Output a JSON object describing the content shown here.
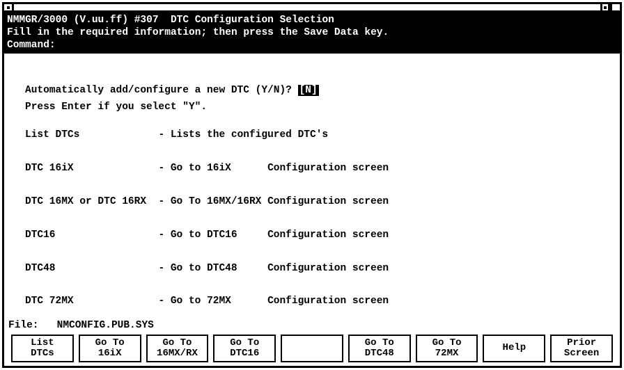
{
  "header": {
    "line1": "NMMGR/3000 (V.uu.ff) #307  DTC Configuration Selection",
    "line2": "Fill in the required information; then press the Save Data key.",
    "command_label": "Command:"
  },
  "prompt": {
    "question": "Automatically add/configure a new DTC (Y/N)? ",
    "value": "N",
    "hint": "Press Enter if you select \"Y\"."
  },
  "options": [
    {
      "name": "List DTCs",
      "desc": "- Lists the configured DTC's"
    },
    {
      "name": "DTC 16iX",
      "desc": "- Go to 16iX      Configuration screen"
    },
    {
      "name": "DTC 16MX or DTC 16RX",
      "desc": "- Go To 16MX/16RX Configuration screen"
    },
    {
      "name": "DTC16",
      "desc": "- Go to DTC16     Configuration screen"
    },
    {
      "name": "DTC48",
      "desc": "- Go to DTC48     Configuration screen"
    },
    {
      "name": "DTC 72MX",
      "desc": "- Go to 72MX      Configuration screen"
    }
  ],
  "file": {
    "label": "File:",
    "value": "NMCONFIG.PUB.SYS"
  },
  "fkeys": [
    {
      "l1": "List",
      "l2": "DTCs"
    },
    {
      "l1": "Go To",
      "l2": "16iX"
    },
    {
      "l1": "Go To",
      "l2": "16MX/RX"
    },
    {
      "l1": "Go To",
      "l2": "DTC16"
    },
    {
      "l1": "",
      "l2": ""
    },
    {
      "l1": "Go To",
      "l2": "DTC48"
    },
    {
      "l1": "Go To",
      "l2": "72MX"
    },
    {
      "l1": "Help",
      "l2": ""
    },
    {
      "l1": "Prior",
      "l2": "Screen"
    }
  ]
}
